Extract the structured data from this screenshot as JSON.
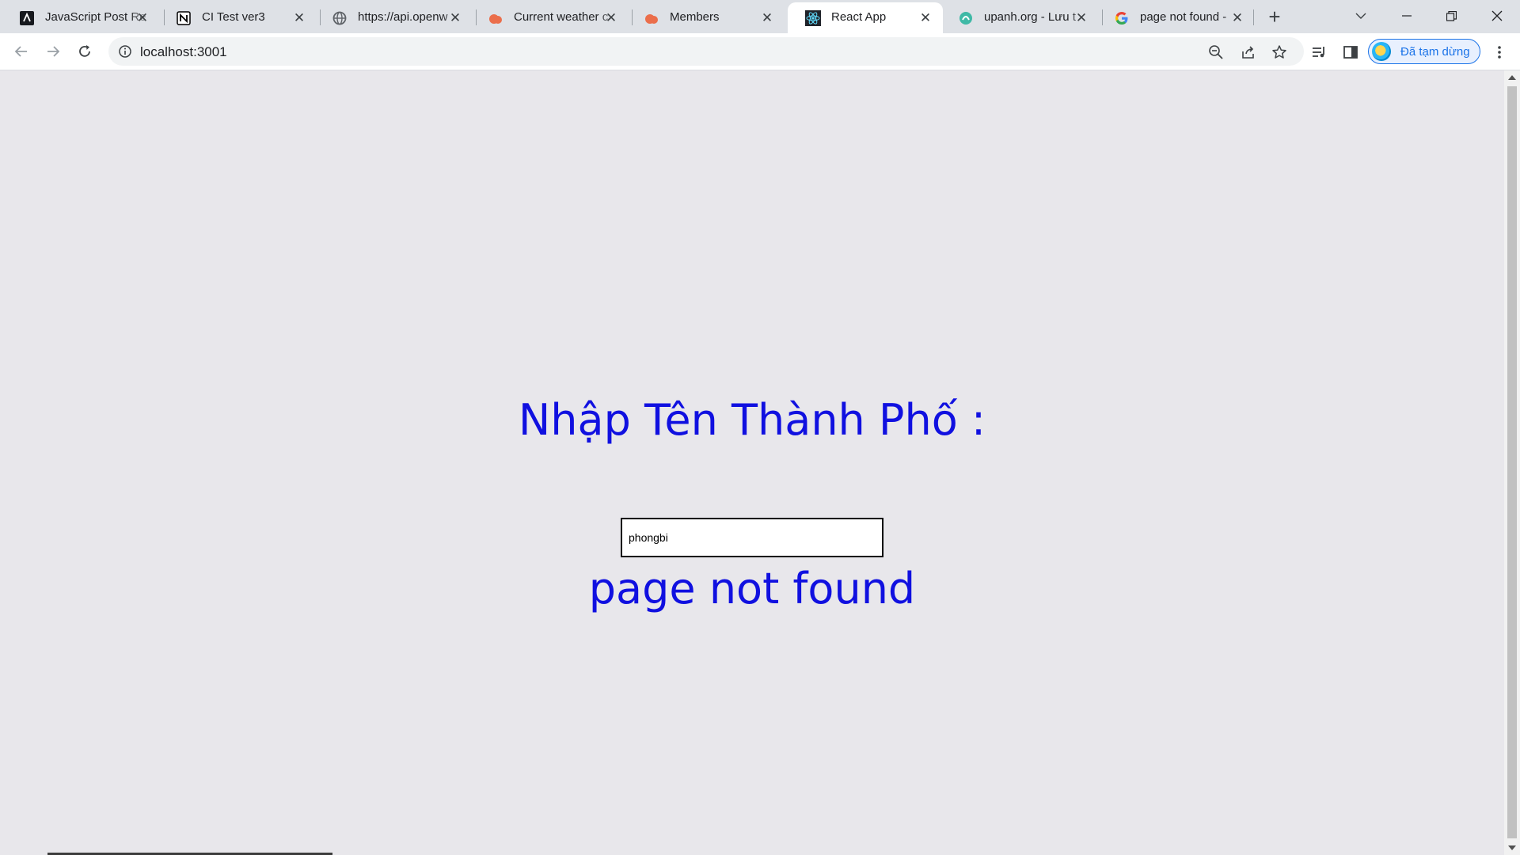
{
  "browser": {
    "tabs": [
      {
        "title": "JavaScript Post Re",
        "icon": "astro-icon",
        "active": false
      },
      {
        "title": "CI Test ver3",
        "icon": "notion-icon",
        "active": false
      },
      {
        "title": "https://api.openw",
        "icon": "globe-icon",
        "active": false
      },
      {
        "title": "Current weather c",
        "icon": "openweather-icon",
        "active": false
      },
      {
        "title": "Members",
        "icon": "openweather-icon",
        "active": false
      },
      {
        "title": "React App",
        "icon": "react-icon",
        "active": true
      },
      {
        "title": "upanh.org - Lưu t",
        "icon": "upanh-icon",
        "active": false
      },
      {
        "title": "page not found -",
        "icon": "google-icon",
        "active": false
      }
    ],
    "address": "localhost:3001",
    "profile_label": "Đã tạm dừng",
    "accent_color": "#1a73e8"
  },
  "page": {
    "heading": "Nhập Tên Thành Phố :",
    "city_input_value": "phongbi",
    "result_text": "page not found",
    "text_color": "#1010e0",
    "background_color": "#e8e7eb"
  }
}
